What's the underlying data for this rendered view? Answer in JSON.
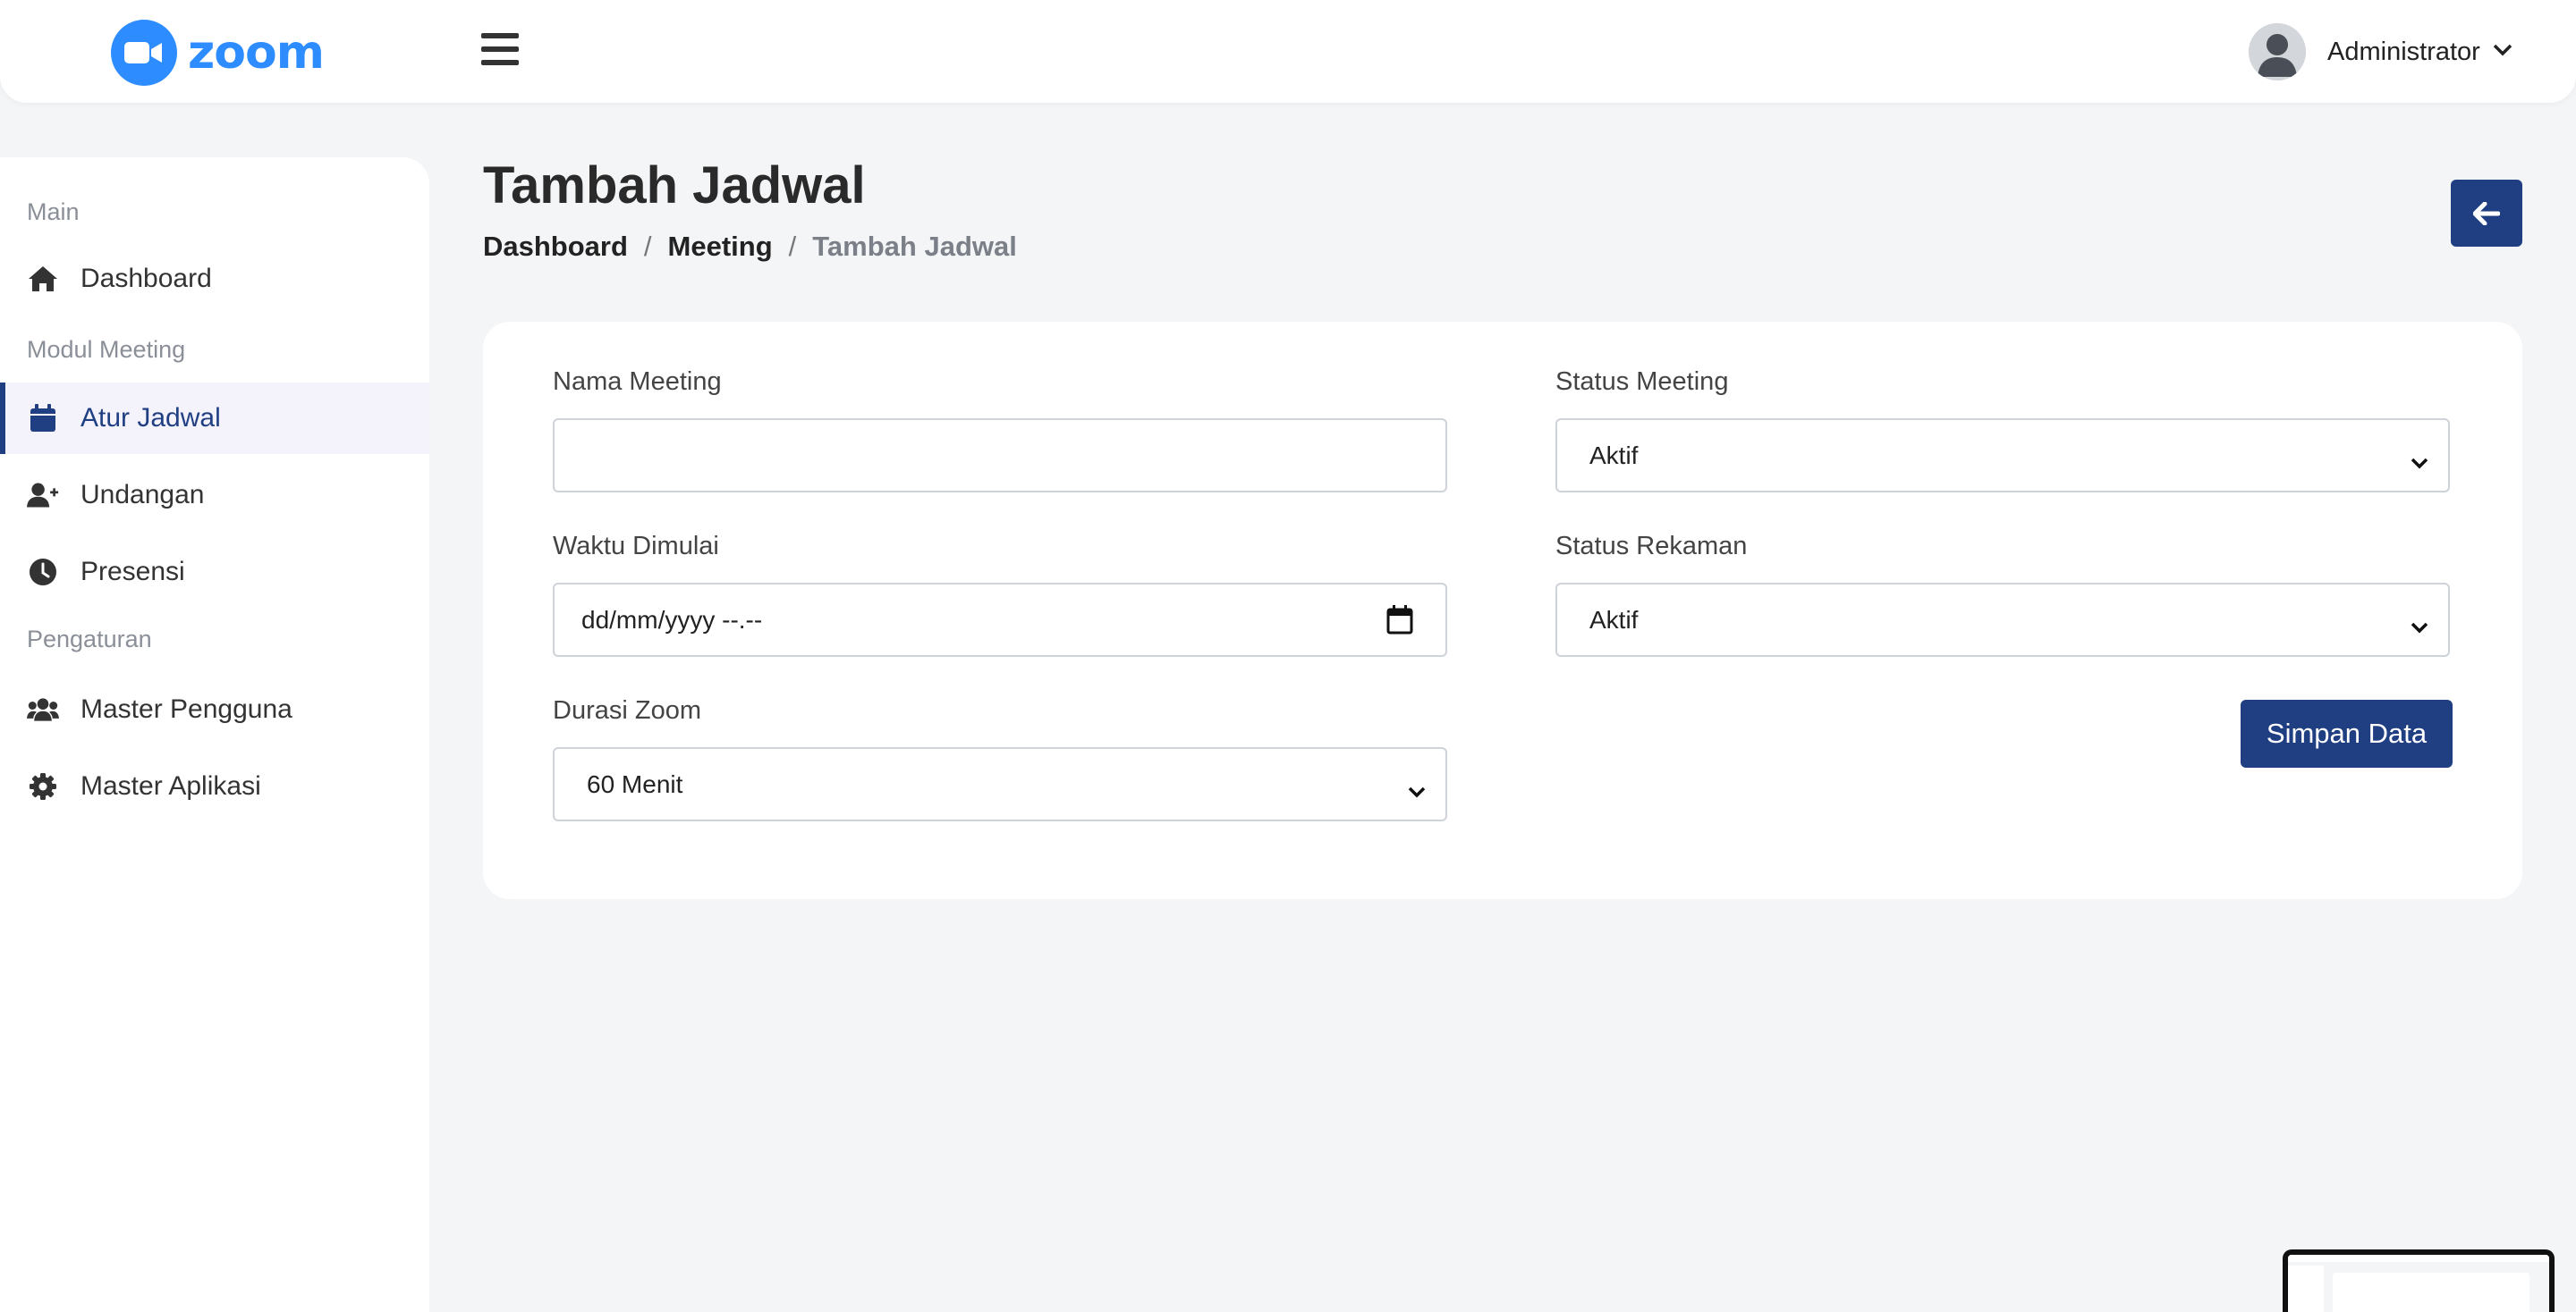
{
  "header": {
    "logo_text": "zoom",
    "user_name": "Administrator"
  },
  "sidebar": {
    "sections": [
      "Main",
      "Modul Meeting",
      "Pengaturan"
    ],
    "items": [
      {
        "label": "Dashboard",
        "icon": "home-icon"
      },
      {
        "label": "Atur Jadwal",
        "icon": "calendar-icon",
        "active": true
      },
      {
        "label": "Undangan",
        "icon": "user-plus-icon"
      },
      {
        "label": "Presensi",
        "icon": "clock-icon"
      },
      {
        "label": "Master Pengguna",
        "icon": "users-icon"
      },
      {
        "label": "Master Aplikasi",
        "icon": "gear-icon"
      }
    ]
  },
  "page": {
    "title": "Tambah Jadwal",
    "breadcrumb": [
      "Dashboard",
      "Meeting",
      "Tambah Jadwal"
    ]
  },
  "form": {
    "nama_meeting_label": "Nama Meeting",
    "nama_meeting_value": "",
    "waktu_dimulai_label": "Waktu Dimulai",
    "waktu_dimulai_placeholder": "dd/mm/yyyy --.--",
    "durasi_zoom_label": "Durasi Zoom",
    "durasi_zoom_value": "60 Menit",
    "status_meeting_label": "Status Meeting",
    "status_meeting_value": "Aktif",
    "status_rekaman_label": "Status Rekaman",
    "status_rekaman_value": "Aktif",
    "save_label": "Simpan Data"
  },
  "colors": {
    "primary": "#1f3f82",
    "zoom_blue": "#2d8cff",
    "background": "#f4f5f7"
  }
}
